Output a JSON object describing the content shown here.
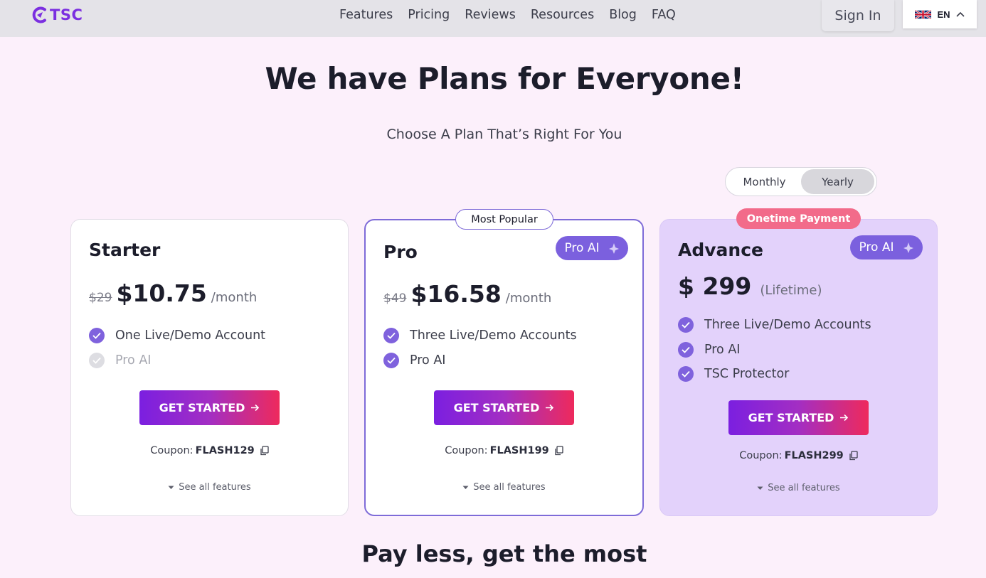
{
  "brand": {
    "logo_text": "TSC"
  },
  "nav": {
    "items": [
      "Features",
      "Pricing",
      "Reviews",
      "Resources",
      "Blog",
      "FAQ"
    ]
  },
  "header": {
    "signin_label": "Sign In",
    "language_code": "EN"
  },
  "hero": {
    "title": "We have Plans for Everyone!",
    "subtitle": "Choose A Plan That’s Right For You"
  },
  "billing_toggle": {
    "options": [
      "Monthly",
      "Yearly"
    ],
    "selected": "Yearly"
  },
  "plans": [
    {
      "name": "Starter",
      "old_price": "$29",
      "price": "$10.75",
      "period": "/month",
      "features": [
        {
          "text": "One Live/Demo Account",
          "included": true
        },
        {
          "text": "Pro AI",
          "included": false
        }
      ],
      "cta": "GET STARTED",
      "coupon_label": "Coupon:",
      "coupon_code": "FLASH129",
      "see_all": "See all features"
    },
    {
      "name": "Pro",
      "badge": "Most Popular",
      "tag": "Pro AI",
      "old_price": "$49",
      "price": "$16.58",
      "period": "/month",
      "features": [
        {
          "text": "Three Live/Demo Accounts",
          "included": true
        },
        {
          "text": "Pro AI",
          "included": true
        }
      ],
      "cta": "GET STARTED",
      "coupon_label": "Coupon:",
      "coupon_code": "FLASH199",
      "see_all": "See all features"
    },
    {
      "name": "Advance",
      "badge": "Onetime Payment",
      "tag": "Pro AI",
      "price": "$ 299",
      "period": "(Lifetime)",
      "features": [
        {
          "text": "Three Live/Demo Accounts",
          "included": true
        },
        {
          "text": "Pro AI",
          "included": true
        },
        {
          "text": "TSC Protector",
          "included": true
        }
      ],
      "cta": "GET STARTED",
      "coupon_label": "Coupon:",
      "coupon_code": "FLASH299",
      "see_all": "See all features"
    }
  ],
  "section_heading": "Pay less, get the most",
  "colors": {
    "brand": "#7b2fe0",
    "check": "#7f62dd",
    "cta_gradient_start": "#7b1fe0",
    "cta_gradient_end": "#ee2a5c",
    "onetime_badge": "#f26b8a",
    "advance_bg": "#e3d2fb"
  },
  "icons": [
    "tsc-logo-icon",
    "uk-flag-icon",
    "chevron-up-icon",
    "check-circle-icon",
    "arrow-right-icon",
    "copy-icon",
    "chevron-down-icon",
    "sparkle-icon"
  ]
}
